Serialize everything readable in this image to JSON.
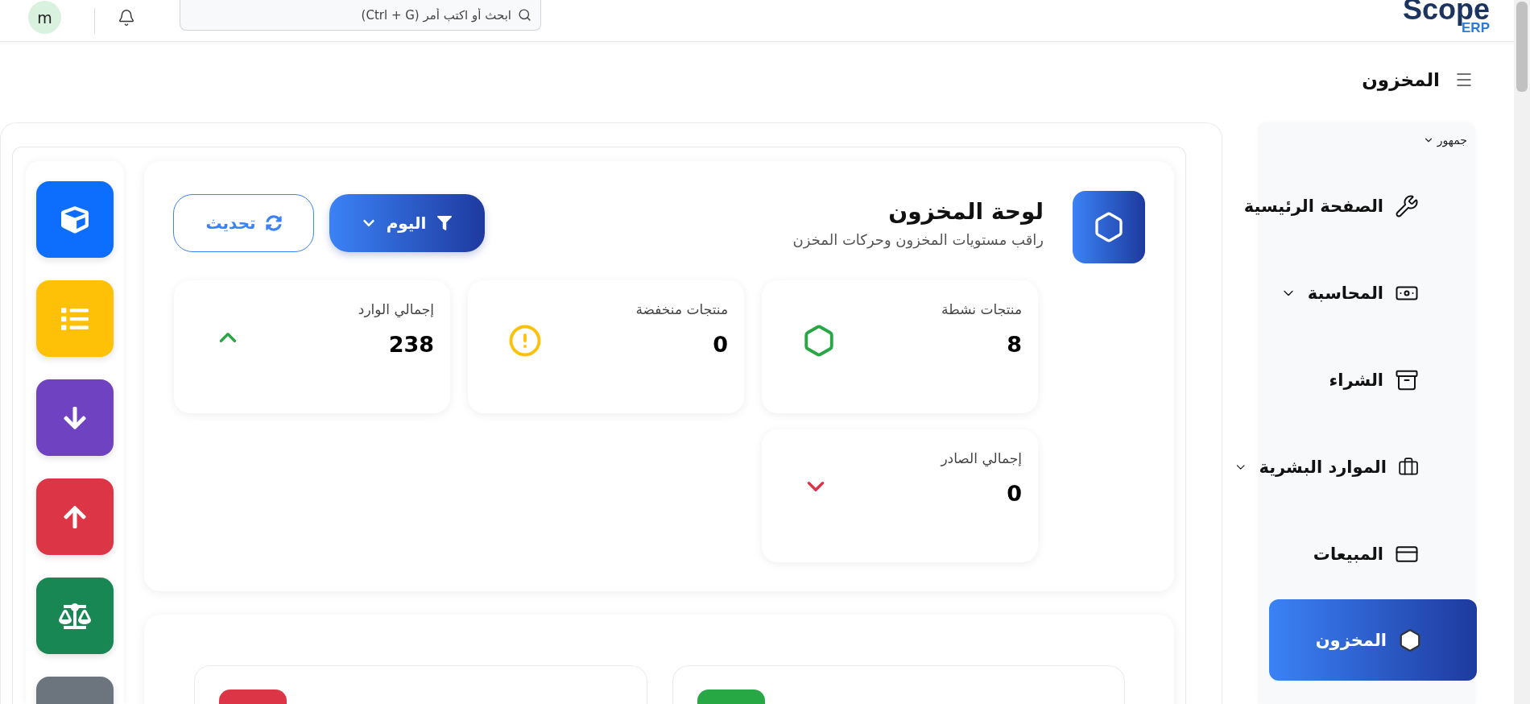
{
  "topbar": {
    "avatar": "m",
    "search": {
      "placeholder": "ابحث أو اكتب أمر (Ctrl + G)"
    },
    "logo": {
      "name": "Scope",
      "suffix": "ERP"
    }
  },
  "page_title": "المخزون",
  "sidebar": {
    "group": "جمهور",
    "items": [
      {
        "label": "الصفحة الرئيسية",
        "expandable": false,
        "selected": false
      },
      {
        "label": "المحاسبة",
        "expandable": true,
        "selected": false
      },
      {
        "label": "الشراء",
        "expandable": false,
        "selected": false
      },
      {
        "label": "الموارد البشرية",
        "expandable": true,
        "selected": false
      },
      {
        "label": "المبيعات",
        "expandable": false,
        "selected": false
      },
      {
        "label": "المخزون",
        "expandable": false,
        "selected": true
      }
    ]
  },
  "quick_actions": [
    {
      "color": "#0d6efd"
    },
    {
      "color": "#ffc107"
    },
    {
      "color": "#6f42c1"
    },
    {
      "color": "#dc3545"
    },
    {
      "color": "#198754"
    },
    {
      "color": "#6c757d"
    }
  ],
  "dashboard": {
    "title": "لوحة المخزون",
    "subtitle": "راقب مستويات المخزون وحركات المخزن",
    "filter_button": "اليوم",
    "refresh_button": "تحديث",
    "stats": [
      {
        "label": "منتجات نشطة",
        "value": "8"
      },
      {
        "label": "منتجات منخفضة",
        "value": "0"
      },
      {
        "label": "إجمالي الوارد",
        "value": "238"
      },
      {
        "label": "إجمالي الصادر",
        "value": "0"
      }
    ]
  },
  "panels": [
    {
      "color": "#28a745"
    },
    {
      "color": "#dc3545"
    }
  ]
}
